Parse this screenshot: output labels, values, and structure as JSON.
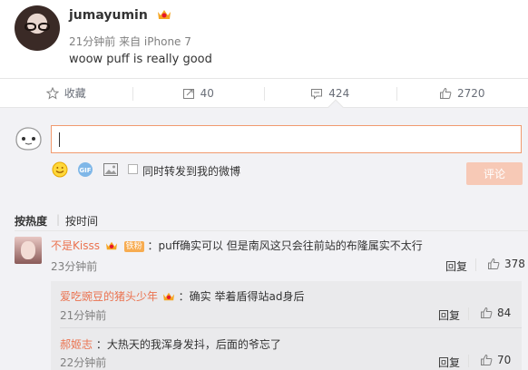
{
  "post": {
    "username": "jumayumin",
    "time": "21分钟前",
    "source": "来自 iPhone 7",
    "text": "woow puff is really good"
  },
  "actions": {
    "favorite": "收藏",
    "repost": "40",
    "comment": "424",
    "like": "2720"
  },
  "composer": {
    "input_value": "",
    "sync_label": "同时转发到我的微博",
    "submit_label": "评论"
  },
  "sort": {
    "hot": "按热度",
    "sep": "|",
    "time": "按时间"
  },
  "comments": [
    {
      "name": "不是Kisss",
      "badge": "铁粉",
      "text": "：puff确实可以 但是南风这只会往前站的布隆属实不太行",
      "time": "23分钟前",
      "reply": "回复",
      "likes": "378",
      "replies": [
        {
          "name": "爱吃豌豆的猪头少年",
          "text": "：确实 举着盾得站ad身后",
          "time": "21分钟前",
          "reply": "回复",
          "likes": "84"
        },
        {
          "name": "郝姬志",
          "text": "：大热天的我浑身发抖，后面的爷忘了",
          "time": "22分钟前",
          "reply": "回复",
          "likes": "70"
        }
      ]
    }
  ],
  "colors": {
    "accent": "#eb7350",
    "input_border": "#f19a6f",
    "submit_bg": "#f7c9b6",
    "comment_bg": "#f2f2f5"
  }
}
